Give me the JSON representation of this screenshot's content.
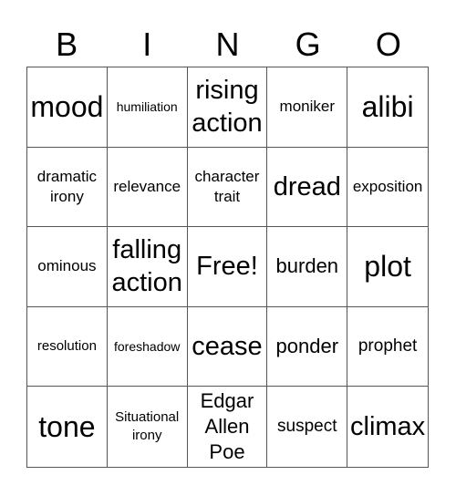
{
  "header": [
    "B",
    "I",
    "N",
    "G",
    "O"
  ],
  "cells": [
    {
      "text": "mood",
      "size": "s-xl"
    },
    {
      "text": "humiliation",
      "size": "s-xxs"
    },
    {
      "text": "rising action",
      "size": "s-l"
    },
    {
      "text": "moniker",
      "size": "s-s"
    },
    {
      "text": "alibi",
      "size": "s-xl"
    },
    {
      "text": "dramatic irony",
      "size": "s-s"
    },
    {
      "text": "relevance",
      "size": "s-s"
    },
    {
      "text": "character trait",
      "size": "s-s"
    },
    {
      "text": "dread",
      "size": "s-l"
    },
    {
      "text": "exposition",
      "size": "s-s"
    },
    {
      "text": "ominous",
      "size": "s-s"
    },
    {
      "text": "falling action",
      "size": "s-l"
    },
    {
      "text": "Free!",
      "size": "s-l"
    },
    {
      "text": "burden",
      "size": "s-m"
    },
    {
      "text": "plot",
      "size": "s-xl"
    },
    {
      "text": "resolution",
      "size": "s-xs"
    },
    {
      "text": "foreshadow",
      "size": "s-xxs"
    },
    {
      "text": "cease",
      "size": "s-l"
    },
    {
      "text": "ponder",
      "size": "s-m"
    },
    {
      "text": "prophet",
      "size": "s-ms"
    },
    {
      "text": "tone",
      "size": "s-xl"
    },
    {
      "text": "Situational irony",
      "size": "s-xs"
    },
    {
      "text": "Edgar Allen Poe",
      "size": "s-m"
    },
    {
      "text": "suspect",
      "size": "s-ms"
    },
    {
      "text": "climax",
      "size": "s-l"
    }
  ]
}
